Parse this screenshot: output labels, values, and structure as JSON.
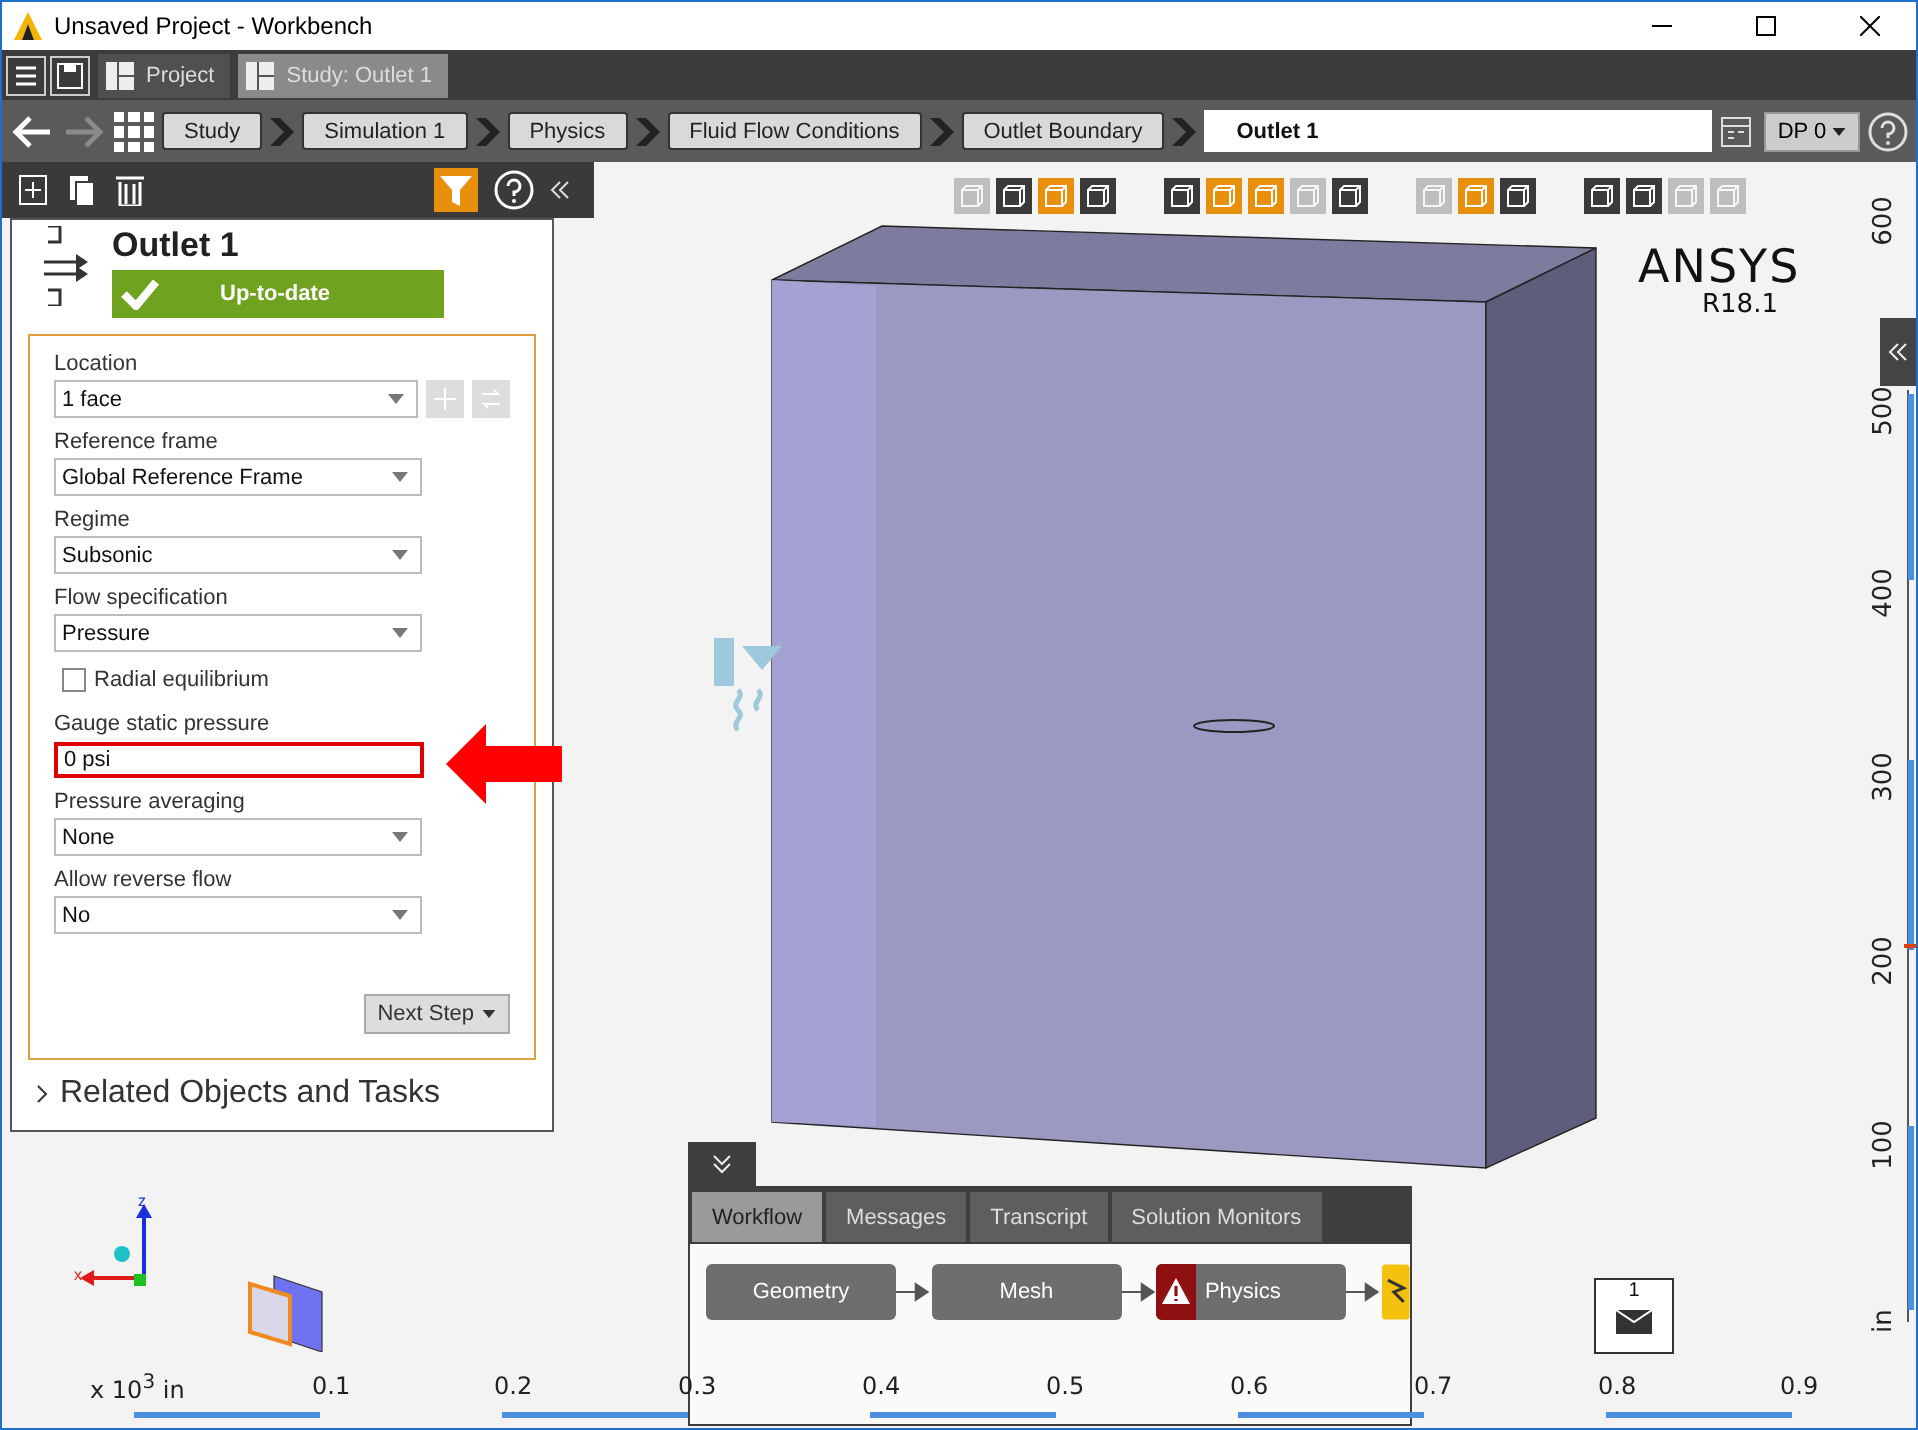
{
  "window": {
    "title": "Unsaved Project - Workbench"
  },
  "top_tabs": [
    {
      "label": "Project",
      "selected": false
    },
    {
      "label": "Study: Outlet 1",
      "selected": true
    }
  ],
  "breadcrumb": [
    {
      "label": "Study",
      "selected": false
    },
    {
      "label": "Simulation 1",
      "selected": false
    },
    {
      "label": "Physics",
      "selected": false
    },
    {
      "label": "Fluid Flow Conditions",
      "selected": false
    },
    {
      "label": "Outlet Boundary",
      "selected": false
    },
    {
      "label": "Outlet 1",
      "selected": true
    }
  ],
  "dp_button": "DP 0",
  "panel": {
    "title": "Outlet 1",
    "status": "Up-to-date",
    "filter_on": true,
    "fields": [
      {
        "kind": "location",
        "label": "Location",
        "value": "1 face"
      },
      {
        "kind": "dropdown",
        "label": "Reference frame",
        "value": "Global Reference Frame"
      },
      {
        "kind": "dropdown",
        "label": "Regime",
        "value": "Subsonic"
      },
      {
        "kind": "dropdown",
        "label": "Flow specification",
        "value": "Pressure"
      },
      {
        "kind": "checkbox",
        "label": "Radial equilibrium",
        "checked": false
      },
      {
        "kind": "text",
        "label": "Gauge static pressure",
        "value": "0 psi",
        "highlighted": true
      },
      {
        "kind": "dropdown",
        "label": "Pressure averaging",
        "value": "None"
      },
      {
        "kind": "dropdown",
        "label": "Allow reverse flow",
        "value": "No"
      }
    ],
    "next_step": "Next Step",
    "related": "Related Objects and Tasks"
  },
  "viewport": {
    "logo": "ANSYS",
    "version": "R18.1",
    "toolbar": [
      [
        {
          "active": false,
          "disabled": true
        },
        {
          "active": false,
          "disabled": false
        },
        {
          "active": true,
          "disabled": false
        },
        {
          "active": false,
          "disabled": false
        }
      ],
      [
        {
          "active": false,
          "disabled": false
        },
        {
          "active": true,
          "disabled": false
        },
        {
          "active": true,
          "disabled": false
        },
        {
          "active": false,
          "disabled": true
        },
        {
          "active": false,
          "disabled": false
        }
      ],
      [
        {
          "active": false,
          "disabled": true
        },
        {
          "active": true,
          "disabled": false
        },
        {
          "active": false,
          "disabled": false
        }
      ],
      [
        {
          "active": false,
          "disabled": false
        },
        {
          "active": false,
          "disabled": false
        },
        {
          "active": false,
          "disabled": true
        },
        {
          "active": false,
          "disabled": true
        }
      ]
    ],
    "axis_labels": [
      "z",
      "x"
    ],
    "vertical_ruler": [
      "600",
      "500",
      "400",
      "300",
      "200",
      "100",
      "in"
    ],
    "horizontal_ruler_unit": "x 10$^{3}$ in",
    "horizontal_ruler": [
      "0.1",
      "0.2",
      "0.3",
      "0.4",
      "0.5",
      "0.6",
      "0.7",
      "0.8",
      "0.9"
    ],
    "message_count": "1"
  },
  "bottom_panel": {
    "tabs": [
      {
        "label": "Workflow",
        "selected": true
      },
      {
        "label": "Messages",
        "selected": false
      },
      {
        "label": "Transcript",
        "selected": false
      },
      {
        "label": "Solution Monitors",
        "selected": false
      }
    ],
    "workflow": [
      {
        "label": "Geometry",
        "warning": false
      },
      {
        "label": "Mesh",
        "warning": false
      },
      {
        "label": "Physics",
        "warning": true
      }
    ]
  }
}
